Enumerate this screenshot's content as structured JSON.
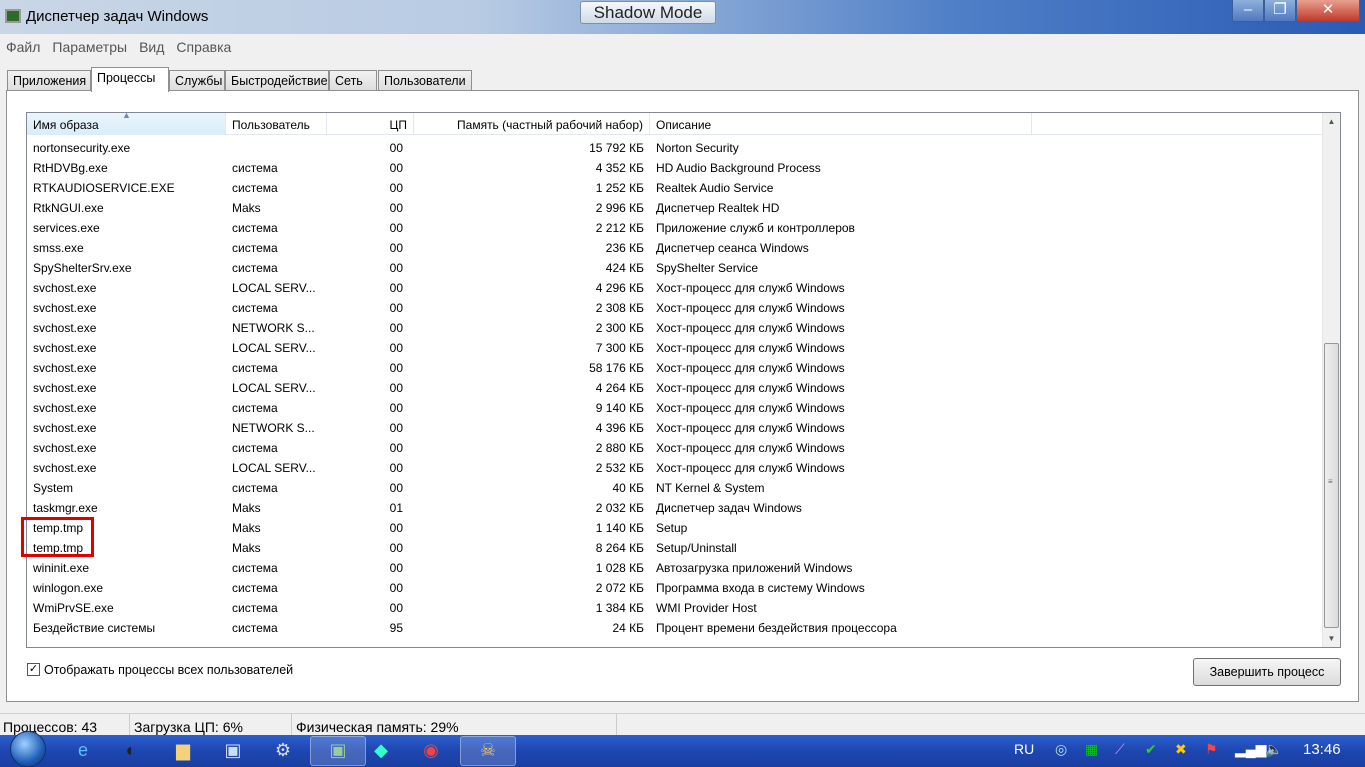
{
  "window": {
    "title": "Диспетчер задач Windows",
    "overlay_label": "Shadow Mode",
    "minimize": "–",
    "maximize": "❐",
    "close": "✕"
  },
  "menu": [
    "Файл",
    "Параметры",
    "Вид",
    "Справка"
  ],
  "tabs": [
    "Приложения",
    "Процессы",
    "Службы",
    "Быстродействие",
    "Сеть",
    "Пользователи"
  ],
  "active_tab": "Процессы",
  "columns": [
    "Имя образа",
    "Пользователь",
    "ЦП",
    "Память (частный рабочий набор)",
    "Описание"
  ],
  "rows": [
    [
      "nortonsecurity.exe",
      "",
      "00",
      "15 792 КБ",
      "Norton Security"
    ],
    [
      "RtHDVBg.exe",
      "система",
      "00",
      "4 352 КБ",
      "HD Audio Background Process"
    ],
    [
      "RTKAUDIOSERVICE.EXE",
      "система",
      "00",
      "1 252 КБ",
      "Realtek Audio Service"
    ],
    [
      "RtkNGUI.exe",
      "Maks",
      "00",
      "2 996 КБ",
      "Диспетчер Realtek HD"
    ],
    [
      "services.exe",
      "система",
      "00",
      "2 212 КБ",
      "Приложение служб и контроллеров"
    ],
    [
      "smss.exe",
      "система",
      "00",
      "236 КБ",
      "Диспетчер сеанса  Windows"
    ],
    [
      "SpyShelterSrv.exe",
      "система",
      "00",
      "424 КБ",
      "SpyShelter Service"
    ],
    [
      "svchost.exe",
      "LOCAL SERV...",
      "00",
      "4 296 КБ",
      "Хост-процесс для служб Windows"
    ],
    [
      "svchost.exe",
      "система",
      "00",
      "2 308 КБ",
      "Хост-процесс для служб Windows"
    ],
    [
      "svchost.exe",
      "NETWORK S...",
      "00",
      "2 300 КБ",
      "Хост-процесс для служб Windows"
    ],
    [
      "svchost.exe",
      "LOCAL SERV...",
      "00",
      "7 300 КБ",
      "Хост-процесс для служб Windows"
    ],
    [
      "svchost.exe",
      "система",
      "00",
      "58 176 КБ",
      "Хост-процесс для служб Windows"
    ],
    [
      "svchost.exe",
      "LOCAL SERV...",
      "00",
      "4 264 КБ",
      "Хост-процесс для служб Windows"
    ],
    [
      "svchost.exe",
      "система",
      "00",
      "9 140 КБ",
      "Хост-процесс для служб Windows"
    ],
    [
      "svchost.exe",
      "NETWORK S...",
      "00",
      "4 396 КБ",
      "Хост-процесс для служб Windows"
    ],
    [
      "svchost.exe",
      "система",
      "00",
      "2 880 КБ",
      "Хост-процесс для служб Windows"
    ],
    [
      "svchost.exe",
      "LOCAL SERV...",
      "00",
      "2 532 КБ",
      "Хост-процесс для служб Windows"
    ],
    [
      "System",
      "система",
      "00",
      "40 КБ",
      "NT Kernel & System"
    ],
    [
      "taskmgr.exe",
      "Maks",
      "01",
      "2 032 КБ",
      "Диспетчер задач Windows"
    ],
    [
      "temp.tmp",
      "Maks",
      "00",
      "1 140 КБ",
      "Setup"
    ],
    [
      "temp.tmp",
      "Maks",
      "00",
      "8 264 КБ",
      "Setup/Uninstall"
    ],
    [
      "wininit.exe",
      "система",
      "00",
      "1 028 КБ",
      "Автозагрузка приложений Windows"
    ],
    [
      "winlogon.exe",
      "система",
      "00",
      "2 072 КБ",
      "Программа входа в систему Windows"
    ],
    [
      "WmiPrvSE.exe",
      "система",
      "00",
      "1 384 КБ",
      "WMI Provider Host"
    ],
    [
      "Бездействие системы",
      "система",
      "95",
      "24 КБ",
      "Процент времени бездействия процессора"
    ]
  ],
  "show_all_users": {
    "label": "Отображать процессы всех пользователей",
    "checked": true
  },
  "end_process_label": "Завершить процесс",
  "status": {
    "processes": "Процессов: 43",
    "cpu": "Загрузка ЦП: 6%",
    "memory": "Физическая память: 29%"
  },
  "taskbar": {
    "language": "RU",
    "clock": "13:46"
  },
  "colors": {
    "highlight": "#e00000"
  }
}
